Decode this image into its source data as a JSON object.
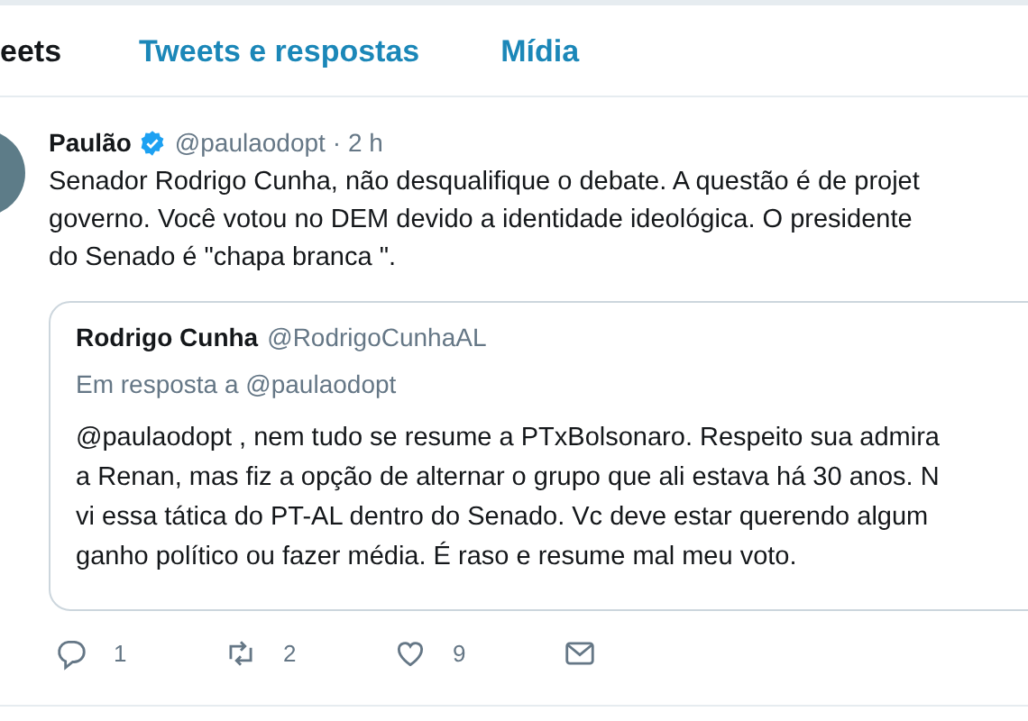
{
  "tabs": [
    {
      "label": "eets",
      "selected": true
    },
    {
      "label": "Tweets e respostas",
      "selected": false
    },
    {
      "label": "Mídia",
      "selected": false
    }
  ],
  "tweet": {
    "author": "Paulão",
    "verified": true,
    "handle": "@paulaodopt",
    "time": "· 2 h",
    "lines": [
      "Senador Rodrigo Cunha, não desqualifique o debate. A questão é de projet",
      "governo. Você votou no DEM devido a identidade  ideológica. O presidente",
      "do Senado é \"chapa branca \"."
    ],
    "quote": {
      "author": "Rodrigo Cunha",
      "handle": "@RodrigoCunhaAL",
      "reply_to": "Em resposta a @paulaodopt",
      "lines": [
        "@paulaodopt , nem tudo se resume a PTxBolsonaro. Respeito sua admira",
        "a Renan, mas fiz a opção de alternar o grupo que ali estava há 30 anos. N",
        "vi essa tática do PT-AL dentro do Senado. Vc deve estar querendo algum",
        "ganho político ou fazer média. É raso e resume mal meu voto."
      ]
    },
    "actions": [
      {
        "kind": "reply",
        "count": "1"
      },
      {
        "kind": "retweet",
        "count": "2"
      },
      {
        "kind": "like",
        "count": "9"
      },
      {
        "kind": "message"
      }
    ]
  }
}
